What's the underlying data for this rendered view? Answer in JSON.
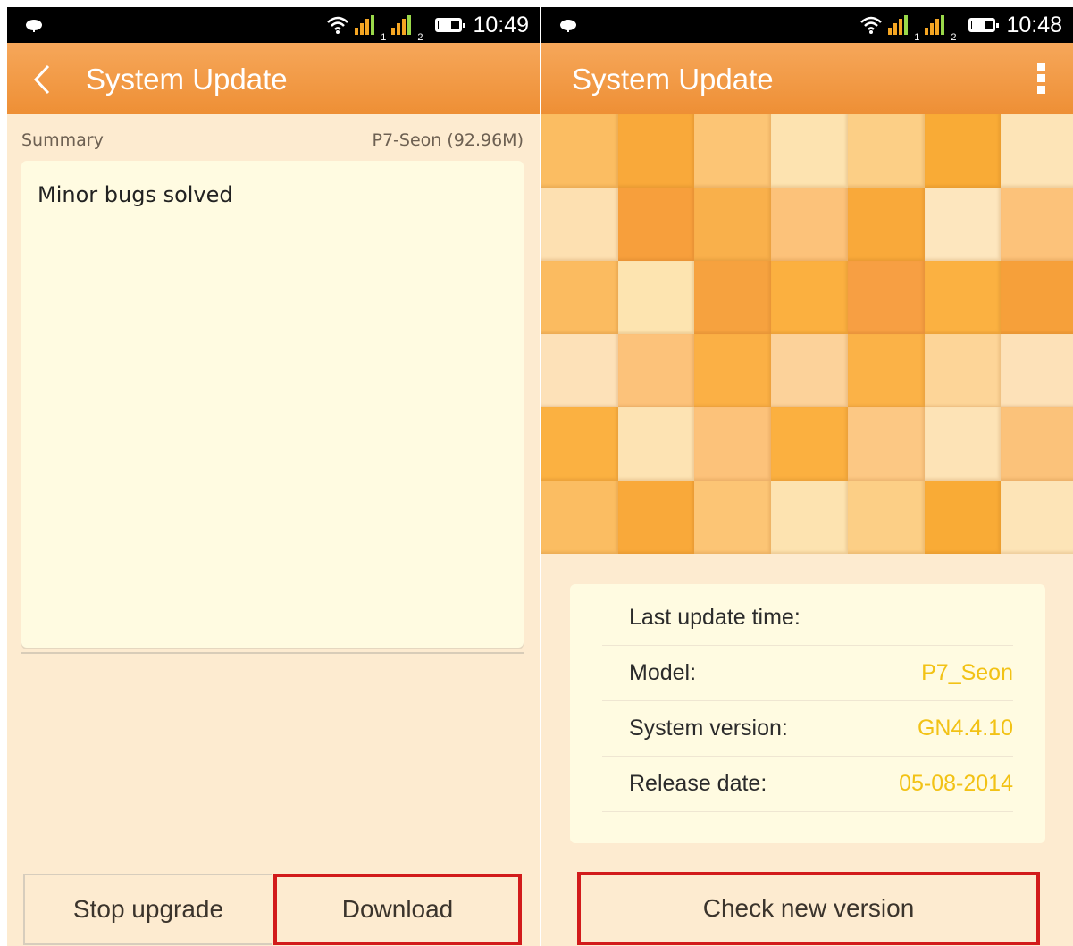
{
  "left": {
    "status": {
      "time": "10:49"
    },
    "appbar": {
      "title": "System Update"
    },
    "summary": {
      "label": "Summary",
      "package": "P7-Seon (92.96M)",
      "notes": "Minor bugs solved"
    },
    "buttons": {
      "stop": "Stop upgrade",
      "download": "Download"
    }
  },
  "right": {
    "status": {
      "time": "10:48"
    },
    "appbar": {
      "title": "System Update"
    },
    "info": {
      "last_update_label": "Last update time:",
      "model_label": "Model:",
      "model_value": "P7_Seon",
      "version_label": "System version:",
      "version_value": "GN4.4.10",
      "release_label": "Release date:",
      "release_value": "05-08-2014"
    },
    "buttons": {
      "check": "Check new version"
    }
  },
  "colors": {
    "accent": "#ee8f35",
    "highlight_border": "#d21b1b",
    "info_value": "#f2c215",
    "mosaic": [
      "#fbbd62",
      "#f9a93a",
      "#fcc575",
      "#fde3b0",
      "#fccf86",
      "#f9ab36",
      "#fde4b7",
      "#fde0b1",
      "#f79f3c",
      "#f9b04b",
      "#fcc27a",
      "#f9a93a",
      "#fde6be",
      "#fcc27a",
      "#fbbb60",
      "#fde4b0",
      "#f6a23f",
      "#fbb040",
      "#f79f43",
      "#fbb141",
      "#f6a03a",
      "#fde1b8",
      "#fcc27a",
      "#fbb045",
      "#fcd29a",
      "#fbb247",
      "#fdd598",
      "#fde1b8",
      "#fbb141",
      "#fde3b3",
      "#fcc27a",
      "#fbb040",
      "#fcc884",
      "#fde3b6",
      "#fbc27a",
      "#fbbd62",
      "#f9a93a",
      "#fcc575",
      "#fde3b0",
      "#fccf86",
      "#f9ab36",
      "#fde4b7"
    ]
  }
}
